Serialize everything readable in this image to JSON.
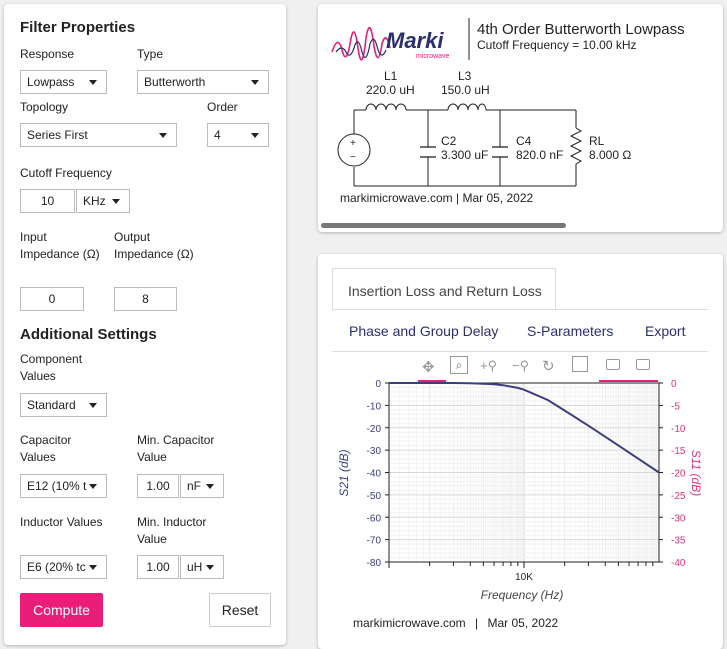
{
  "colors": {
    "accent": "#ea1e79",
    "navy": "#2a2f6e",
    "curve": "#3b3f7f",
    "s11": "#e0337a"
  },
  "filter": {
    "title": "Filter Properties",
    "response_label": "Response",
    "response_value": "Lowpass",
    "type_label": "Type",
    "type_value": "Butterworth",
    "topology_label": "Topology",
    "topology_value": "Series First",
    "order_label": "Order",
    "order_value": "4",
    "cutoff_label": "Cutoff Frequency",
    "cutoff_value": "10",
    "cutoff_unit": "KHz",
    "input_imp_label": "Input Impedance (Ω)",
    "input_imp_value": "0",
    "output_imp_label": "Output Impedance (Ω)",
    "output_imp_value": "8"
  },
  "additional": {
    "title": "Additional Settings",
    "component_values_label": "Component Values",
    "component_values_value": "Standard",
    "cap_values_label": "Capacitor Values",
    "cap_values_value": "E12 (10% t",
    "min_cap_label": "Min. Capacitor Value",
    "min_cap_value": "1.00",
    "min_cap_unit": "nF",
    "ind_values_label": "Inductor Values",
    "ind_values_value": "E6 (20% tc",
    "min_ind_label": "Min. Inductor Value",
    "min_ind_value": "1.00",
    "min_ind_unit": "uH"
  },
  "buttons": {
    "compute": "Compute",
    "reset": "Reset"
  },
  "schematic": {
    "logo_text": "Marki",
    "logo_sub": "microwave",
    "title": "4th Order Butterworth Lowpass",
    "subtitle": "Cutoff Frequency = 10.00 kHz",
    "l1_name": "L1",
    "l1_value": "220.0 uH",
    "l3_name": "L3",
    "l3_value": "150.0 uH",
    "c2_name": "C2",
    "c2_value": "3.300 uF",
    "c4_name": "C4",
    "c4_value": "820.0 nF",
    "rl_name": "RL",
    "rl_value": "8.000 Ω",
    "source_plus": "+",
    "source_minus": "−",
    "footer": "markimicrowave.com | Mar 05, 2022"
  },
  "tabs": {
    "active": "Insertion Loss and Return Loss",
    "phase": "Phase and Group Delay",
    "sparams": "S-Parameters",
    "export": "Export"
  },
  "plot_footer": {
    "site": "markimicrowave.com",
    "sep": "|",
    "date": "Mar 05, 2022"
  },
  "chart_data": {
    "type": "line",
    "xlabel": "Frequency (Hz)",
    "ylabel": "S21 (dB)",
    "y2label": "S11 (dB)",
    "xscale": "log",
    "xtick_labels": [
      "10K"
    ],
    "ylim": [
      -80,
      0
    ],
    "y2lim": [
      -40,
      0
    ],
    "yticks": [
      0,
      -10,
      -20,
      -30,
      -40,
      -50,
      -60,
      -70,
      -80
    ],
    "y2ticks": [
      0,
      -5,
      -10,
      -15,
      -20,
      -25,
      -30,
      -35,
      -40
    ],
    "grid": true,
    "series": [
      {
        "name": "S21",
        "x": [
          1000,
          2000,
          3000,
          4000,
          5000,
          6000,
          7000,
          8000,
          9000,
          10000,
          15000,
          20000,
          30000,
          50000,
          70000,
          100000
        ],
        "values": [
          0,
          -0.01,
          -0.02,
          -0.1,
          -0.3,
          -0.6,
          -1.0,
          -1.6,
          -2.2,
          -3.0,
          -7.6,
          -12.3,
          -19.1,
          -27.9,
          -33.8,
          -40.0
        ]
      }
    ]
  },
  "toolbar": {
    "move_icon": "move-icon",
    "zoom_icon": "zoom-box-icon",
    "zoom_in_icon": "zoom-in-icon",
    "zoom_out_icon": "zoom-out-icon",
    "reset_icon": "reset-icon",
    "save_icon": "save-icon",
    "hover1_icon": "hover-closest-icon",
    "hover2_icon": "hover-compare-icon"
  }
}
